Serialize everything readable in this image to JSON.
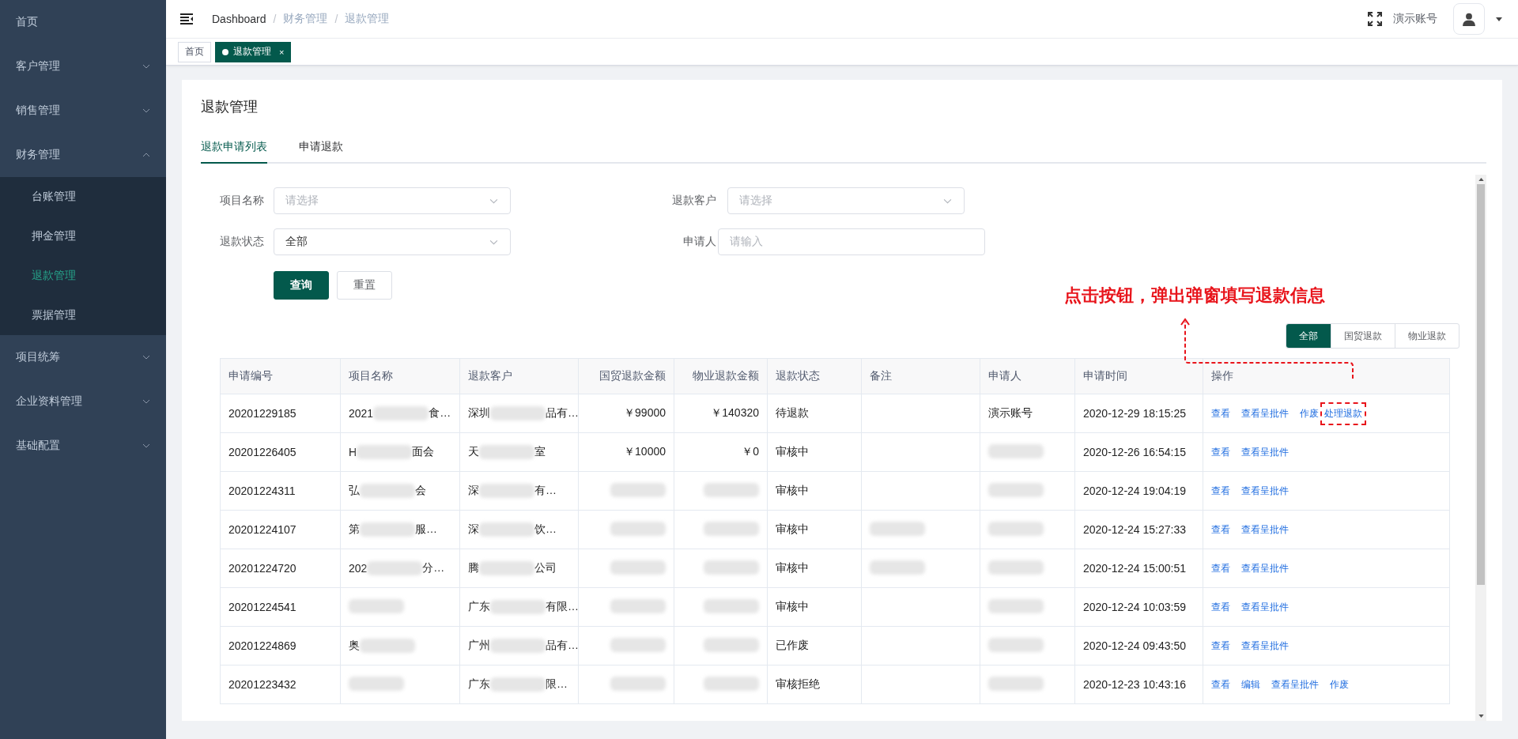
{
  "sidebar": {
    "items": [
      {
        "label": "首页",
        "kind": "link"
      },
      {
        "label": "客户管理",
        "kind": "group",
        "expanded": false
      },
      {
        "label": "销售管理",
        "kind": "group",
        "expanded": false
      },
      {
        "label": "财务管理",
        "kind": "group",
        "expanded": true,
        "children": [
          {
            "label": "台账管理",
            "selected": false
          },
          {
            "label": "押金管理",
            "selected": false
          },
          {
            "label": "退款管理",
            "selected": true
          },
          {
            "label": "票据管理",
            "selected": false
          }
        ]
      },
      {
        "label": "项目统筹",
        "kind": "group",
        "expanded": false
      },
      {
        "label": "企业资料管理",
        "kind": "group",
        "expanded": false
      },
      {
        "label": "基础配置",
        "kind": "group",
        "expanded": false
      }
    ]
  },
  "header": {
    "breadcrumb": [
      "Dashboard",
      "财务管理",
      "退款管理"
    ],
    "breadcrumb_separator": "/",
    "user": "演示账号"
  },
  "tags": [
    {
      "label": "首页",
      "selected": false
    },
    {
      "label": "退款管理",
      "selected": true,
      "close": "×"
    }
  ],
  "page_title": "退款管理",
  "tabs": [
    {
      "label": "退款申请列表",
      "selected": true
    },
    {
      "label": "申请退款",
      "selected": false
    }
  ],
  "filters": [
    {
      "label": "项目名称",
      "kind": "select",
      "placeholder": "请选择"
    },
    {
      "label": "退款客户",
      "kind": "select",
      "placeholder": "请选择"
    },
    {
      "label": "退款状态",
      "kind": "select",
      "value": "全部"
    },
    {
      "label": "申请人",
      "kind": "input",
      "placeholder": "请输入"
    }
  ],
  "buttons": [
    {
      "label": "查询",
      "primary": true
    },
    {
      "label": "重置",
      "primary": false
    }
  ],
  "annotation": "点击按钮，弹出弹窗填写退款信息",
  "type_filter": [
    {
      "label": "全部",
      "selected": true
    },
    {
      "label": "国贸退款",
      "selected": false
    },
    {
      "label": "物业退款",
      "selected": false
    }
  ],
  "table": {
    "columns": [
      "申请编号",
      "项目名称",
      "退款客户",
      "国贸退款金额",
      "物业退款金额",
      "退款状态",
      "备注",
      "申请人",
      "申请时间",
      "操作"
    ],
    "rows": [
      {
        "cells": [
          [
            {
              "text": "20201229185"
            }
          ],
          [
            {
              "text": "2021"
            },
            {
              "kind": "blur"
            },
            {
              "text": "食…"
            }
          ],
          [
            {
              "text": "深圳"
            },
            {
              "kind": "blur"
            },
            {
              "text": "品有…"
            }
          ],
          [
            {
              "text": "￥99000"
            }
          ],
          [
            {
              "text": "￥140320"
            }
          ],
          [
            {
              "text": "待退款"
            }
          ],
          [],
          [
            {
              "text": "演示账号"
            }
          ],
          [
            {
              "text": "2020-12-29 18:15:25"
            }
          ]
        ],
        "actions": [
          {
            "label": "查看",
            "highlighted": false
          },
          {
            "label": "查看呈批件",
            "highlighted": false
          },
          {
            "label": "作废",
            "highlighted": false
          },
          {
            "label": "处理退款",
            "highlighted": true
          }
        ]
      },
      {
        "cells": [
          [
            {
              "text": "20201226405"
            }
          ],
          [
            {
              "text": "H"
            },
            {
              "kind": "blur"
            },
            {
              "text": "面会"
            }
          ],
          [
            {
              "text": "天"
            },
            {
              "kind": "blur"
            },
            {
              "text": "室"
            }
          ],
          [
            {
              "text": "￥10000"
            }
          ],
          [
            {
              "text": "￥0"
            }
          ],
          [
            {
              "text": "审核中"
            }
          ],
          [],
          [
            {
              "kind": "blur"
            }
          ],
          [
            {
              "text": "2020-12-26 16:54:15"
            }
          ]
        ],
        "actions": [
          {
            "label": "查看",
            "highlighted": false
          },
          {
            "label": "查看呈批件",
            "highlighted": false
          }
        ]
      },
      {
        "cells": [
          [
            {
              "text": "20201224311"
            }
          ],
          [
            {
              "text": "弘"
            },
            {
              "kind": "blur"
            },
            {
              "text": "会"
            }
          ],
          [
            {
              "text": "深"
            },
            {
              "kind": "blur"
            },
            {
              "text": "有…"
            }
          ],
          [
            {
              "kind": "blur"
            }
          ],
          [
            {
              "kind": "blur"
            }
          ],
          [
            {
              "text": "审核中"
            }
          ],
          [],
          [
            {
              "kind": "blur"
            }
          ],
          [
            {
              "text": "2020-12-24 19:04:19"
            }
          ]
        ],
        "actions": [
          {
            "label": "查看",
            "highlighted": false
          },
          {
            "label": "查看呈批件",
            "highlighted": false
          }
        ]
      },
      {
        "cells": [
          [
            {
              "text": "20201224107"
            }
          ],
          [
            {
              "text": "第"
            },
            {
              "kind": "blur"
            },
            {
              "text": "服…"
            }
          ],
          [
            {
              "text": "深"
            },
            {
              "kind": "blur"
            },
            {
              "text": "饮…"
            }
          ],
          [
            {
              "kind": "blur"
            }
          ],
          [
            {
              "kind": "blur"
            }
          ],
          [
            {
              "text": "审核中"
            }
          ],
          [
            {
              "kind": "blur"
            }
          ],
          [
            {
              "kind": "blur"
            }
          ],
          [
            {
              "text": "2020-12-24 15:27:33"
            }
          ]
        ],
        "actions": [
          {
            "label": "查看",
            "highlighted": false
          },
          {
            "label": "查看呈批件",
            "highlighted": false
          }
        ]
      },
      {
        "cells": [
          [
            {
              "text": "20201224720"
            }
          ],
          [
            {
              "text": "202"
            },
            {
              "kind": "blur"
            },
            {
              "text": "分…"
            }
          ],
          [
            {
              "text": "腾"
            },
            {
              "kind": "blur"
            },
            {
              "text": "公司"
            }
          ],
          [
            {
              "kind": "blur"
            }
          ],
          [
            {
              "kind": "blur"
            }
          ],
          [
            {
              "text": "审核中"
            }
          ],
          [
            {
              "kind": "blur"
            }
          ],
          [
            {
              "kind": "blur"
            }
          ],
          [
            {
              "text": "2020-12-24 15:00:51"
            }
          ]
        ],
        "actions": [
          {
            "label": "查看",
            "highlighted": false
          },
          {
            "label": "查看呈批件",
            "highlighted": false
          }
        ]
      },
      {
        "cells": [
          [
            {
              "text": "20201224541"
            }
          ],
          [
            {
              "kind": "blur"
            }
          ],
          [
            {
              "text": "广东"
            },
            {
              "kind": "blur"
            },
            {
              "text": "有限…"
            }
          ],
          [
            {
              "kind": "blur"
            }
          ],
          [
            {
              "kind": "blur"
            }
          ],
          [
            {
              "text": "审核中"
            }
          ],
          [],
          [
            {
              "kind": "blur"
            }
          ],
          [
            {
              "text": "2020-12-24 10:03:59"
            }
          ]
        ],
        "actions": [
          {
            "label": "查看",
            "highlighted": false
          },
          {
            "label": "查看呈批件",
            "highlighted": false
          }
        ]
      },
      {
        "cells": [
          [
            {
              "text": "20201224869"
            }
          ],
          [
            {
              "text": "奥"
            },
            {
              "kind": "blur"
            }
          ],
          [
            {
              "text": "广州"
            },
            {
              "kind": "blur"
            },
            {
              "text": "品有…"
            }
          ],
          [
            {
              "kind": "blur"
            }
          ],
          [
            {
              "kind": "blur"
            }
          ],
          [
            {
              "text": "已作废"
            }
          ],
          [],
          [
            {
              "kind": "blur"
            }
          ],
          [
            {
              "text": "2020-12-24 09:43:50"
            }
          ]
        ],
        "actions": [
          {
            "label": "查看",
            "highlighted": false
          },
          {
            "label": "查看呈批件",
            "highlighted": false
          }
        ]
      },
      {
        "cells": [
          [
            {
              "text": "20201223432"
            }
          ],
          [
            {
              "kind": "blur"
            }
          ],
          [
            {
              "text": "广东"
            },
            {
              "kind": "blur"
            },
            {
              "text": "限…"
            }
          ],
          [
            {
              "kind": "blur"
            }
          ],
          [
            {
              "kind": "blur"
            }
          ],
          [
            {
              "text": "审核拒绝"
            }
          ],
          [],
          [
            {
              "kind": "blur"
            }
          ],
          [
            {
              "text": "2020-12-23 10:43:16"
            }
          ]
        ],
        "actions": [
          {
            "label": "查看",
            "highlighted": false
          },
          {
            "label": "编辑",
            "highlighted": false
          },
          {
            "label": "查看呈批件",
            "highlighted": false
          },
          {
            "label": "作废",
            "highlighted": false
          }
        ]
      }
    ]
  }
}
